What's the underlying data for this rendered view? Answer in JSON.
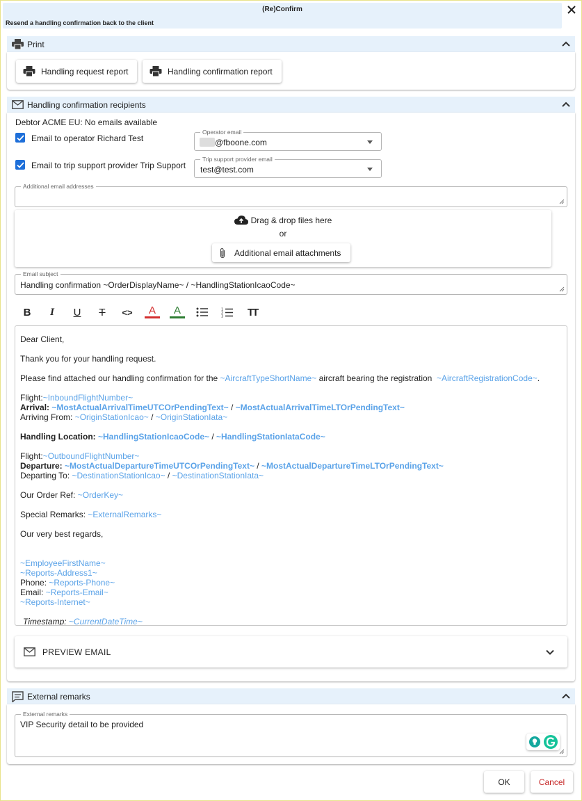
{
  "dialog": {
    "title": "(Re)Confirm",
    "subtitle": "Resend a handling confirmation back to the client",
    "close_icon": "close-icon"
  },
  "print_section": {
    "title": "Print",
    "icon": "printer-icon",
    "buttons": [
      {
        "label": "Handling request report",
        "icon": "printer-icon"
      },
      {
        "label": "Handling confirmation report",
        "icon": "printer-icon"
      }
    ]
  },
  "recipients_section": {
    "title": "Handling confirmation recipients",
    "icon": "mail-icon",
    "debtor_note": "Debtor ACME EU: No emails available",
    "operator_checkbox_label": "Email to operator Richard Test",
    "operator_checked": true,
    "operator_email_label": "Operator email",
    "operator_email_value": "@fboone.com",
    "trip_checkbox_label": "Email to trip support provider Trip Support",
    "trip_checked": true,
    "trip_email_label": "Trip support provider email",
    "trip_email_value": "test@test.com",
    "additional_label": "Additional email addresses",
    "additional_value": "",
    "dropzone_text": "Drag & drop files here",
    "dropzone_or": "or",
    "attachments_button": "Additional email attachments",
    "subject_label": "Email subject",
    "subject_value": "Handling confirmation ~OrderDisplayName~ / ~HandlingStationIcaoCode~",
    "toolbar": {
      "bold": "B",
      "italic": "I",
      "underline": "U",
      "strike": "T",
      "code": "<>",
      "font_color": "A",
      "highlight": "A",
      "font_color_hex": "#d32f2f",
      "highlight_hex": "#2e7d32",
      "text_size": "TT"
    },
    "body": {
      "greeting": "Dear Client,",
      "thanks": "Thank you for your handling request.",
      "find_pre": "Please find attached our handling confirmation for the ",
      "aircraft_type": "~AircraftTypeShortName~",
      "find_mid": " aircraft bearing the registration  ",
      "aircraft_reg": "~AircraftRegistrationCode~",
      "find_post": ".",
      "flight_label": "Flight:",
      "inbound_flight": "~InboundFlightNumber~",
      "arrival_label": "Arrival: ",
      "arrival_utc": "~MostActualArrivalTimeUTCOrPendingText~",
      "slash": " / ",
      "arrival_lt": "~MostActualArrivalTimeLTOrPendingText~",
      "arriving_from_label": "Arriving From: ",
      "origin_icao": "~OriginStationIcao~",
      "origin_iata": "~OriginStationIata~",
      "handling_location_label": "Handling Location: ",
      "handling_icao": "~HandlingStationIcaoCode~",
      "handling_iata": "~HandlingStationIataCode~",
      "outbound_flight": "~OutboundFlightNumber~",
      "departure_label": "Departure: ",
      "departure_utc": "~MostActualDepartureTimeUTCOrPendingText~",
      "departure_lt": "~MostActualDepartureTimeLTOrPendingText~",
      "departing_to_label": "Departing To: ",
      "dest_icao": "~DestinationStationIcao~",
      "dest_iata": "~DestinationStationIata~",
      "order_ref_label": "Our Order Ref: ",
      "order_key": "~OrderKey~",
      "special_remarks_label": "Special Remarks: ",
      "external_remarks_var": "~ExternalRemarks~",
      "regards": "Our very best regards,",
      "employee_name": "~EmployeeFirstName~",
      "reports_address": "~Reports-Address1~",
      "phone_label": "Phone: ",
      "reports_phone": "~Reports-Phone~",
      "email_label": "Email: ",
      "reports_email": "~Reports-Email~",
      "reports_internet": "~Reports-Internet~",
      "timestamp_label": "Timestamp: ",
      "current_datetime": "~CurrentDateTime~"
    },
    "preview_label": "PREVIEW EMAIL"
  },
  "remarks_section": {
    "title": "External remarks",
    "icon": "comment-icon",
    "field_label": "External remarks",
    "field_value": "VIP Security detail to be provided"
  },
  "footer": {
    "ok": "OK",
    "cancel": "Cancel"
  },
  "colors": {
    "accent": "#1e6fd9",
    "variable": "#5ba3e8",
    "section_bg": "#e6f1fb",
    "cancel": "#c62828"
  }
}
